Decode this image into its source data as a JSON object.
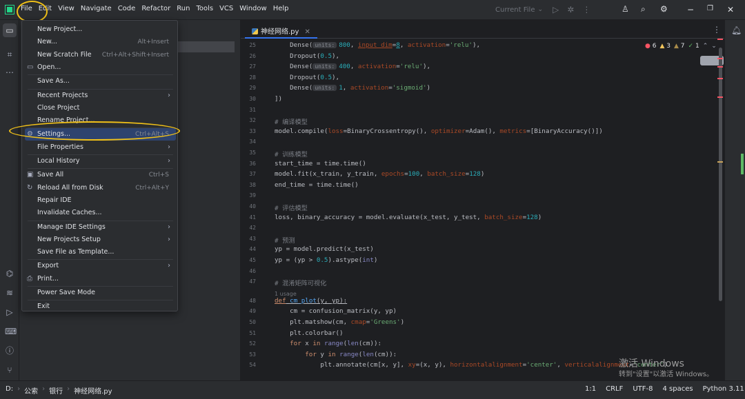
{
  "menubar": [
    "File",
    "Edit",
    "View",
    "Navigate",
    "Code",
    "Refactor",
    "Run",
    "Tools",
    "VCS",
    "Window",
    "Help"
  ],
  "toolbar": {
    "run_config": "Current File"
  },
  "editor": {
    "tab": "神经网络.py",
    "inspections": {
      "errors": "6",
      "warnings": "3",
      "weak_warnings": "7",
      "ok": "1"
    },
    "lines": [
      {
        "n": "25",
        "html": "    Dense(<span class=\"hint\">units:</span><span class=\"num\">800</span>, <span class=\"kwa\"><u>input_dim</u></span>=<span class=\"num\"><u>8</u></span>, <span class=\"kwa\">activation</span>=<span class=\"str\">'relu'</span>),"
      },
      {
        "n": "26",
        "html": "    Dropout(<span class=\"num\">0.5</span>),"
      },
      {
        "n": "27",
        "html": "    Dense(<span class=\"hint\">units:</span><span class=\"num\">400</span>, <span class=\"kwa\">activation</span>=<span class=\"str\">'relu'</span>),"
      },
      {
        "n": "28",
        "html": "    Dropout(<span class=\"num\">0.5</span>),"
      },
      {
        "n": "29",
        "html": "    Dense(<span class=\"hint\">units:</span><span class=\"num\">1</span>, <span class=\"kwa\">activation</span>=<span class=\"str\">'sigmoid'</span>)"
      },
      {
        "n": "30",
        "html": "])"
      },
      {
        "n": "31",
        "html": ""
      },
      {
        "n": "32",
        "html": "<span class=\"cm\"># 编译模型</span>"
      },
      {
        "n": "33",
        "html": "model.compile(<span class=\"kwa\">loss</span>=BinaryCrossentropy(), <span class=\"kwa\">optimizer</span>=Adam(), <span class=\"kwa\">metrics</span>=[BinaryAccuracy()])"
      },
      {
        "n": "34",
        "html": ""
      },
      {
        "n": "35",
        "html": "<span class=\"cm\"># 训练模型</span>"
      },
      {
        "n": "36",
        "html": "start_time = time.time()"
      },
      {
        "n": "37",
        "html": "model.fit(x_train, y_train, <span class=\"kwa\">epochs</span>=<span class=\"num\">100</span>, <span class=\"kwa\">batch_size</span>=<span class=\"num\">128</span>)"
      },
      {
        "n": "38",
        "html": "end_time = time.time()"
      },
      {
        "n": "39",
        "html": ""
      },
      {
        "n": "40",
        "html": "<span class=\"cm\"># 评估模型</span>"
      },
      {
        "n": "41",
        "html": "loss, binary_accuracy = model.evaluate(x_test, y_test, <span class=\"kwa\">batch_size</span>=<span class=\"num\">128</span>)"
      },
      {
        "n": "42",
        "html": ""
      },
      {
        "n": "43",
        "html": "<span class=\"cm\"># 预测</span>"
      },
      {
        "n": "44",
        "html": "yp = model.predict(x_test)"
      },
      {
        "n": "45",
        "html": "yp = (yp &gt; <span class=\"num\">0.5</span>).astype(<span class=\"bi\">int</span>)"
      },
      {
        "n": "46",
        "html": ""
      },
      {
        "n": "47",
        "html": "<span class=\"cm\"># 混淆矩阵可视化</span>"
      },
      {
        "n": "48",
        "html": "<span class=\"kw\"><u>def</u></span><u> <span class=\"fn\">cm_plot</span>(y, yp):</u>"
      },
      {
        "n": "49",
        "html": "    cm = confusion_matrix(y, yp)"
      },
      {
        "n": "50",
        "html": "    plt.matshow(cm, <span class=\"kwa\">cmap</span>=<span class=\"str\">'Greens'</span>)"
      },
      {
        "n": "51",
        "html": "    plt.colorbar()"
      },
      {
        "n": "52",
        "html": "    <span class=\"kw\">for</span> x <span class=\"kw\">in</span> <span class=\"bi\">range</span>(<span class=\"bi\">len</span>(cm)):"
      },
      {
        "n": "53",
        "html": "        <span class=\"kw\">for</span> y <span class=\"kw\">in</span> <span class=\"bi\">range</span>(<span class=\"bi\">len</span>(cm)):"
      },
      {
        "n": "54",
        "html": "            plt.annotate(cm[x, y], <span class=\"kwa\">xy</span>=(x, y), <span class=\"kwa\">horizontalalignment</span>=<span class=\"str\">'center'</span>, <span class=\"kwa\">verticalalignment</span>=<span class=\"str\">'center'</span>)"
      }
    ],
    "usage_label": "1 usage"
  },
  "file_menu": [
    {
      "label": "New Project...",
      "type": "item"
    },
    {
      "label": "New...",
      "shortcut": "Alt+Insert",
      "type": "item"
    },
    {
      "label": "New Scratch File",
      "shortcut": "Ctrl+Alt+Shift+Insert",
      "type": "item"
    },
    {
      "label": "Open...",
      "icon": "folder-icon",
      "type": "item"
    },
    {
      "label": "Save As...",
      "type": "item"
    },
    {
      "label": "Recent Projects",
      "submenu": true,
      "type": "item"
    },
    {
      "label": "Close Project",
      "type": "item"
    },
    {
      "label": "Rename Project...",
      "type": "item"
    },
    {
      "label": "Settings...",
      "shortcut": "Ctrl+Alt+S",
      "icon": "gear-icon",
      "selected": true,
      "type": "item"
    },
    {
      "label": "File Properties",
      "submenu": true,
      "type": "item"
    },
    {
      "label": "Local History",
      "submenu": true,
      "type": "item"
    },
    {
      "label": "Save All",
      "shortcut": "Ctrl+S",
      "icon": "save-icon",
      "type": "item"
    },
    {
      "label": "Reload All from Disk",
      "shortcut": "Ctrl+Alt+Y",
      "icon": "reload-icon",
      "type": "item"
    },
    {
      "label": "Repair IDE",
      "type": "item"
    },
    {
      "label": "Invalidate Caches...",
      "type": "item"
    },
    {
      "label": "Manage IDE Settings",
      "submenu": true,
      "type": "item"
    },
    {
      "label": "New Projects Setup",
      "submenu": true,
      "type": "item"
    },
    {
      "label": "Save File as Template...",
      "type": "item"
    },
    {
      "label": "Export",
      "submenu": true,
      "type": "item"
    },
    {
      "label": "Print...",
      "icon": "print-icon",
      "type": "item"
    },
    {
      "label": "Power Save Mode",
      "type": "item"
    },
    {
      "label": "Exit",
      "type": "item"
    }
  ],
  "statusbar": {
    "breadcrumbs": [
      "D:",
      "公索",
      "银行",
      "神经网络.py"
    ],
    "position": "1:1",
    "line_sep": "CRLF",
    "encoding": "UTF-8",
    "indent": "4 spaces",
    "interpreter": "Python 3.11"
  },
  "watermark": {
    "line1": "激活 Windows",
    "line2": "转到\"设置\"以激活 Windows。"
  }
}
